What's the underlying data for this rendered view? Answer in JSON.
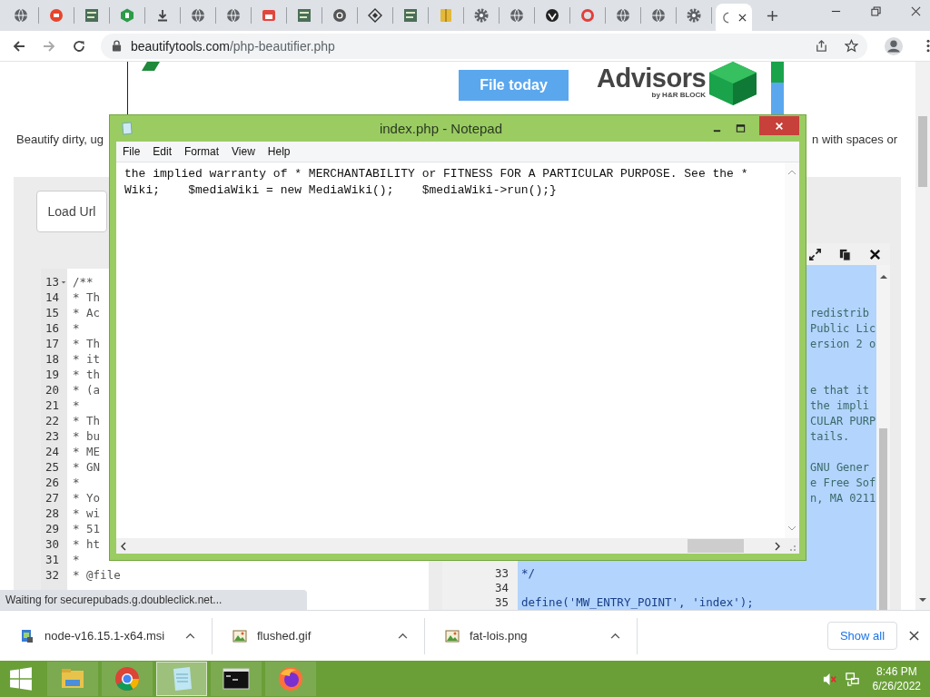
{
  "browser": {
    "tabs": [
      {
        "kind": "globe",
        "selected": false
      },
      {
        "kind": "badge",
        "selected": false
      },
      {
        "kind": "database",
        "selected": false
      },
      {
        "kind": "hexagon",
        "selected": false
      },
      {
        "kind": "download",
        "selected": false
      },
      {
        "kind": "globe",
        "selected": false
      },
      {
        "kind": "globe",
        "selected": false
      },
      {
        "kind": "store",
        "selected": false
      },
      {
        "kind": "database",
        "selected": false
      },
      {
        "kind": "chrome",
        "selected": false
      },
      {
        "kind": "diamond",
        "selected": false
      },
      {
        "kind": "database",
        "selected": false
      },
      {
        "kind": "folder",
        "selected": false
      },
      {
        "kind": "gear",
        "selected": false
      },
      {
        "kind": "globe",
        "selected": false
      },
      {
        "kind": "emblem",
        "selected": false
      },
      {
        "kind": "ring",
        "selected": false
      },
      {
        "kind": "globe",
        "selected": false
      },
      {
        "kind": "globe",
        "selected": false
      },
      {
        "kind": "gear",
        "selected": false
      },
      {
        "kind": "loading",
        "selected": true
      }
    ],
    "url": {
      "domain": "beautifytools.com",
      "path": "/php-beautifier.php"
    }
  },
  "ad": {
    "button": "File today",
    "brand": "Advisors",
    "byline": "by H&R BLOCK"
  },
  "intro": {
    "left": "Beautify dirty, ug",
    "right": "n with spaces or"
  },
  "load_button": "Load Url",
  "left_editor": {
    "lines": [
      {
        "number": "13",
        "code": "/**",
        "fold": true
      },
      {
        "number": "14",
        "code": "* Th",
        "fold": false
      },
      {
        "number": "15",
        "code": "* Ac",
        "fold": false
      },
      {
        "number": "16",
        "code": "*",
        "fold": false
      },
      {
        "number": "17",
        "code": "* Th",
        "fold": false
      },
      {
        "number": "18",
        "code": "* it",
        "fold": false
      },
      {
        "number": "19",
        "code": "* th",
        "fold": false
      },
      {
        "number": "20",
        "code": "* (a",
        "fold": false
      },
      {
        "number": "21",
        "code": "*",
        "fold": false
      },
      {
        "number": "22",
        "code": "* Th",
        "fold": false
      },
      {
        "number": "23",
        "code": "* bu",
        "fold": false
      },
      {
        "number": "24",
        "code": "* ME",
        "fold": false
      },
      {
        "number": "25",
        "code": "* GN",
        "fold": false
      },
      {
        "number": "26",
        "code": "*",
        "fold": false
      },
      {
        "number": "27",
        "code": "* Yo",
        "fold": false
      },
      {
        "number": "28",
        "code": "* wi",
        "fold": false
      },
      {
        "number": "29",
        "code": "* 51",
        "fold": false
      },
      {
        "number": "30",
        "code": "* ht",
        "fold": false
      },
      {
        "number": "31",
        "code": "*",
        "fold": false
      },
      {
        "number": "32",
        "code": "* @file",
        "fold": false
      }
    ]
  },
  "right_editor": {
    "fragment_groups": [
      [
        "redistrib",
        "Public Lic",
        "ersion 2 o"
      ],
      [
        "e that it",
        "the impli",
        "CULAR PURP",
        "tails."
      ],
      [
        "GNU Gener",
        "e Free Sof",
        "n, MA 0211"
      ]
    ],
    "lines": [
      {
        "number": "33",
        "code": "*/"
      },
      {
        "number": "34"
      },
      {
        "number": "35",
        "code": "define('MW_ENTRY_POINT', 'index');"
      }
    ]
  },
  "status": "Waiting for securepubads.g.doubleclick.net...",
  "notepad": {
    "title": "index.php - Notepad",
    "menu": [
      "File",
      "Edit",
      "Format",
      "View",
      "Help"
    ],
    "lines": [
      "the implied warranty of * MERCHANTABILITY or FITNESS FOR A PARTICULAR PURPOSE. See the *",
      "Wiki;    $mediaWiki = new MediaWiki();    $mediaWiki->run();}"
    ]
  },
  "downloads": {
    "items": [
      {
        "name": "node-v16.15.1-x64.msi",
        "kind": "installer"
      },
      {
        "name": "flushed.gif",
        "kind": "image"
      },
      {
        "name": "fat-lois.png",
        "kind": "image"
      }
    ],
    "show_all": "Show all"
  },
  "taskbar": {
    "apps": [
      {
        "kind": "explorer",
        "selected": false
      },
      {
        "kind": "chrome",
        "selected": false
      },
      {
        "kind": "notepad",
        "selected": true
      },
      {
        "kind": "cmd",
        "selected": false
      },
      {
        "kind": "firefox",
        "selected": false
      }
    ],
    "time": "8:46 PM",
    "date": "6/26/2022"
  }
}
